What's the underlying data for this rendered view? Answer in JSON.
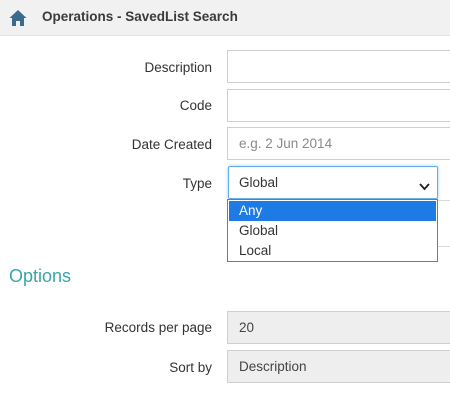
{
  "header": {
    "title": "Operations - SavedList Search",
    "icon": "home-icon"
  },
  "form": {
    "description": {
      "label": "Description",
      "value": ""
    },
    "code": {
      "label": "Code",
      "value": ""
    },
    "date_created": {
      "label": "Date Created",
      "value": "",
      "placeholder": "e.g. 2 Jun 2014"
    },
    "type": {
      "label": "Type",
      "selected": "Global",
      "options": [
        "Any",
        "Global",
        "Local"
      ],
      "highlighted_option": "Any"
    }
  },
  "options_section": {
    "title": "Options",
    "records_per_page": {
      "label": "Records per page",
      "value": "20"
    },
    "sort_by": {
      "label": "Sort by",
      "value": "Description"
    }
  },
  "colors": {
    "accent": "#3aa5a6",
    "selection": "#1e7be6",
    "focus_border": "#66afe9",
    "header_bg": "#f1f1f1"
  }
}
